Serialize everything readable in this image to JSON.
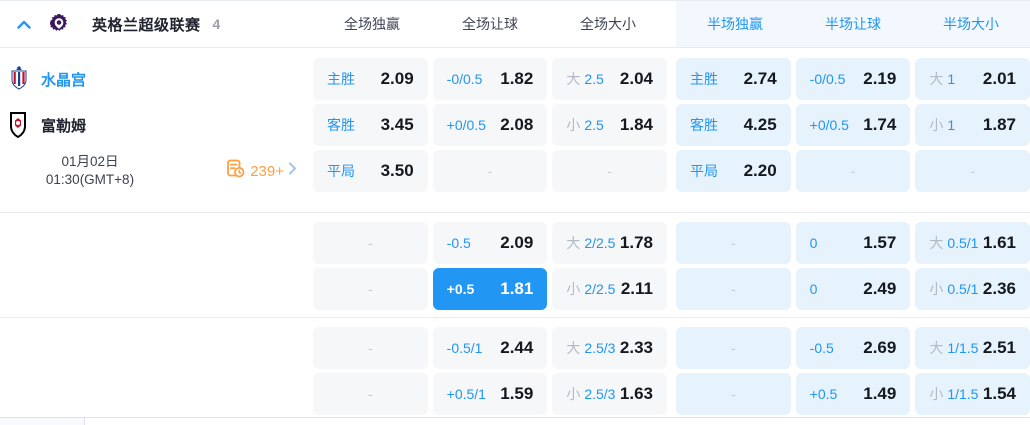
{
  "header": {
    "league": "英格兰超级联赛",
    "count": "4",
    "columns": [
      {
        "label": "全场独赢"
      },
      {
        "label": "全场让球"
      },
      {
        "label": "全场大小"
      },
      {
        "label": "半场独赢"
      },
      {
        "label": "半场让球"
      },
      {
        "label": "半场大小"
      }
    ]
  },
  "match": {
    "home": "水晶宫",
    "away": "富勒姆",
    "date": "01月02日",
    "time": "01:30(GMT+8)",
    "more_markets": "239+"
  },
  "colors": {
    "accent_blue": "#2196f3",
    "selected_cell_bg": "#2196f3",
    "ft_cell_bg": "#f6f7f9",
    "ht_cell_bg": "#e6f2fc",
    "ht_header_bg": "#f2f8fe",
    "orange": "#ff9e43",
    "value_text": "#15181e",
    "gray_prefix": "#b3b9c5"
  },
  "icons": {
    "collapse": "chevron-up-icon",
    "league_logo": "premier-league-lion-icon",
    "home_crest": "crystal-palace-crest-icon",
    "away_crest": "fulham-crest-icon",
    "markets": "odds-list-clock-icon",
    "markets_arrow": "chevron-right-icon"
  },
  "odds": {
    "groups": [
      {
        "rows": [
          [
            {
              "type": "win",
              "zone": "ft",
              "label": "主胜",
              "value": "2.09"
            },
            {
              "type": "hdp",
              "zone": "ft",
              "label": "-0/0.5",
              "value": "1.82"
            },
            {
              "type": "ou",
              "zone": "ft",
              "prefix": "大",
              "line": "2.5",
              "value": "2.04"
            },
            {
              "type": "win",
              "zone": "ht",
              "label": "主胜",
              "value": "2.74"
            },
            {
              "type": "hdp",
              "zone": "ht",
              "label": "-0/0.5",
              "value": "2.19"
            },
            {
              "type": "ou",
              "zone": "ht",
              "prefix": "大",
              "line": "1",
              "value": "2.01"
            }
          ],
          [
            {
              "type": "win",
              "zone": "ft",
              "label": "客胜",
              "value": "3.45"
            },
            {
              "type": "hdp",
              "zone": "ft",
              "label": "+0/0.5",
              "value": "2.08"
            },
            {
              "type": "ou",
              "zone": "ft",
              "prefix": "小",
              "line": "2.5",
              "value": "1.84"
            },
            {
              "type": "win",
              "zone": "ht",
              "label": "客胜",
              "value": "4.25"
            },
            {
              "type": "hdp",
              "zone": "ht",
              "label": "+0/0.5",
              "value": "1.74"
            },
            {
              "type": "ou",
              "zone": "ht",
              "prefix": "小",
              "line": "1",
              "value": "1.87"
            }
          ],
          [
            {
              "type": "win",
              "zone": "ft",
              "label": "平局",
              "value": "3.50"
            },
            {
              "type": "empty",
              "zone": "ft"
            },
            {
              "type": "empty",
              "zone": "ft"
            },
            {
              "type": "win",
              "zone": "ht",
              "label": "平局",
              "value": "2.20"
            },
            {
              "type": "empty",
              "zone": "ht"
            },
            {
              "type": "empty",
              "zone": "ht"
            }
          ]
        ]
      },
      {
        "rows": [
          [
            {
              "type": "empty",
              "zone": "ft"
            },
            {
              "type": "hdp",
              "zone": "ft",
              "label": "-0.5",
              "value": "2.09"
            },
            {
              "type": "ou",
              "zone": "ft",
              "prefix": "大",
              "line": "2/2.5",
              "value": "1.78"
            },
            {
              "type": "empty",
              "zone": "ht"
            },
            {
              "type": "hdp",
              "zone": "ht",
              "label": "0",
              "value": "1.57"
            },
            {
              "type": "ou",
              "zone": "ht",
              "prefix": "大",
              "line": "0.5/1",
              "value": "1.61"
            }
          ],
          [
            {
              "type": "empty",
              "zone": "ft"
            },
            {
              "type": "hdp",
              "zone": "ft",
              "label": "+0.5",
              "value": "1.81",
              "selected": true
            },
            {
              "type": "ou",
              "zone": "ft",
              "prefix": "小",
              "line": "2/2.5",
              "value": "2.11"
            },
            {
              "type": "empty",
              "zone": "ht"
            },
            {
              "type": "hdp",
              "zone": "ht",
              "label": "0",
              "value": "2.49"
            },
            {
              "type": "ou",
              "zone": "ht",
              "prefix": "小",
              "line": "0.5/1",
              "value": "2.36"
            }
          ]
        ]
      },
      {
        "rows": [
          [
            {
              "type": "empty",
              "zone": "ft"
            },
            {
              "type": "hdp",
              "zone": "ft",
              "label": "-0.5/1",
              "value": "2.44"
            },
            {
              "type": "ou",
              "zone": "ft",
              "prefix": "大",
              "line": "2.5/3",
              "value": "2.33"
            },
            {
              "type": "empty",
              "zone": "ht"
            },
            {
              "type": "hdp",
              "zone": "ht",
              "label": "-0.5",
              "value": "2.69"
            },
            {
              "type": "ou",
              "zone": "ht",
              "prefix": "大",
              "line": "1/1.5",
              "value": "2.51"
            }
          ],
          [
            {
              "type": "empty",
              "zone": "ft"
            },
            {
              "type": "hdp",
              "zone": "ft",
              "label": "+0.5/1",
              "value": "1.59"
            },
            {
              "type": "ou",
              "zone": "ft",
              "prefix": "小",
              "line": "2.5/3",
              "value": "1.63"
            },
            {
              "type": "empty",
              "zone": "ht"
            },
            {
              "type": "hdp",
              "zone": "ht",
              "label": "+0.5",
              "value": "1.49"
            },
            {
              "type": "ou",
              "zone": "ht",
              "prefix": "小",
              "line": "1/1.5",
              "value": "1.54"
            }
          ]
        ]
      }
    ]
  }
}
